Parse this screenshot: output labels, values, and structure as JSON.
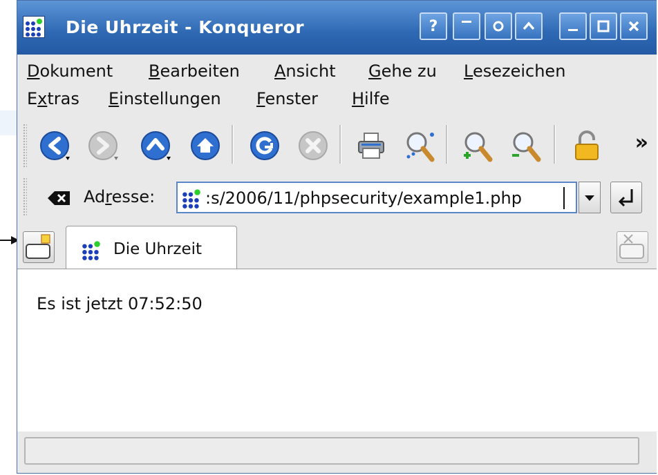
{
  "window": {
    "title": "Die Uhrzeit - Konqueror",
    "buttons": {
      "help": "?",
      "minimize": "_",
      "maximize": "□",
      "close": "X"
    }
  },
  "menu": {
    "row1": [
      {
        "prefix": "",
        "accel": "D",
        "rest": "okument"
      },
      {
        "prefix": "",
        "accel": "B",
        "rest": "earbeiten"
      },
      {
        "prefix": "",
        "accel": "A",
        "rest": "nsicht"
      },
      {
        "prefix": "",
        "accel": "G",
        "rest": "ehe zu"
      },
      {
        "prefix": "",
        "accel": "L",
        "rest": "esezeichen"
      }
    ],
    "row2": [
      {
        "prefix": "E",
        "accel": "x",
        "rest": "tras"
      },
      {
        "prefix": "",
        "accel": "E",
        "rest": "instellungen"
      },
      {
        "prefix": "",
        "accel": "F",
        "rest": "enster"
      },
      {
        "prefix": "",
        "accel": "H",
        "rest": "ilfe"
      }
    ]
  },
  "toolbar": {
    "more_label": "»",
    "icons": [
      "back-icon",
      "forward-icon",
      "up-icon",
      "home-icon",
      "reload-icon",
      "stop-icon",
      "print-icon",
      "find-icon",
      "zoom-in-icon",
      "zoom-out-icon",
      "security-lock-icon"
    ]
  },
  "address": {
    "label_prefix": "Ad",
    "label_accel": "r",
    "label_rest": "esse:",
    "url": ":s/2006/11/phpsecurity/example1.php"
  },
  "tab": {
    "label": "Die Uhrzeit"
  },
  "page": {
    "text": "Es ist jetzt 07:52:50"
  },
  "colors": {
    "titlebar": "#2e68b3",
    "accent": "#5a86c8",
    "background": "#e9e9e9"
  }
}
